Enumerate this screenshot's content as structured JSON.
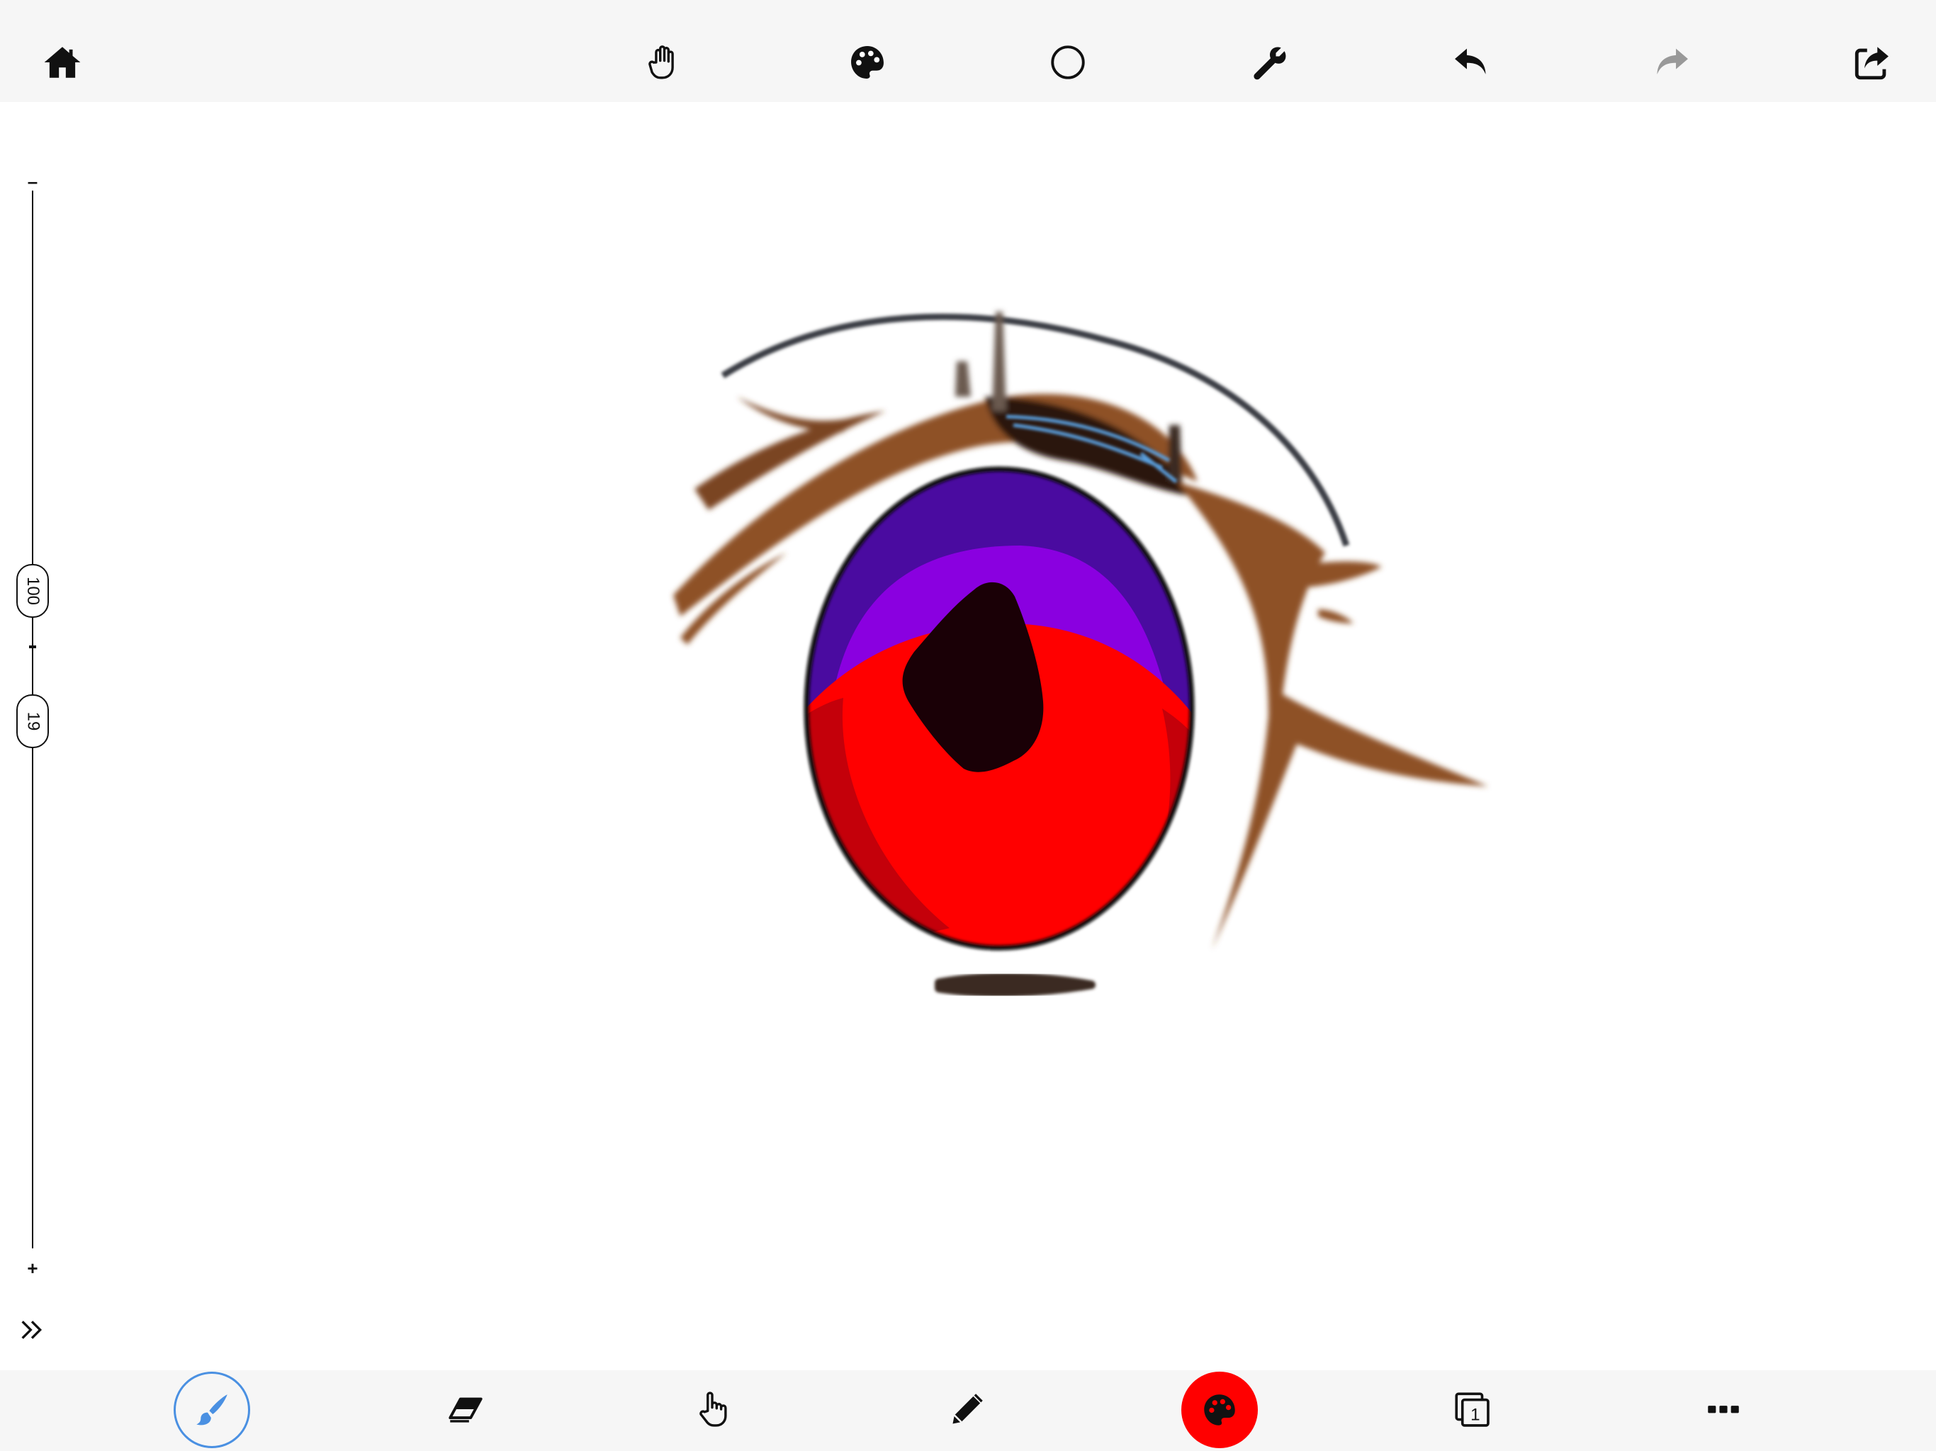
{
  "top_toolbar": {
    "icons": [
      "home-icon",
      "hand-icon",
      "palette-icon",
      "circle-icon",
      "wrench-icon",
      "undo-icon",
      "redo-icon",
      "share-icon"
    ]
  },
  "side_slider": {
    "top_symbol": "–",
    "size_value": "100",
    "middle_symbol": "–",
    "opacity_value": "19",
    "bottom_symbol": "+"
  },
  "bottom_toolbar": {
    "icons": [
      "brush-icon",
      "eraser-icon",
      "finger-smudge-icon",
      "pencil-icon",
      "color-palette-icon",
      "layers-icon",
      "more-icon"
    ],
    "layer_count": "1",
    "current_color": "#ff0000",
    "active_tool_color": "#4a90e2"
  },
  "colors": {
    "toolbar_bg": "#f6f6f6",
    "icon": "#111111",
    "icon_disabled": "#999999",
    "iris_top": "#4a0ba0",
    "iris_mid": "#8a00e0",
    "iris_bottom": "#ff0000",
    "pupil": "#1a0006",
    "lash": "#8a4a22"
  }
}
